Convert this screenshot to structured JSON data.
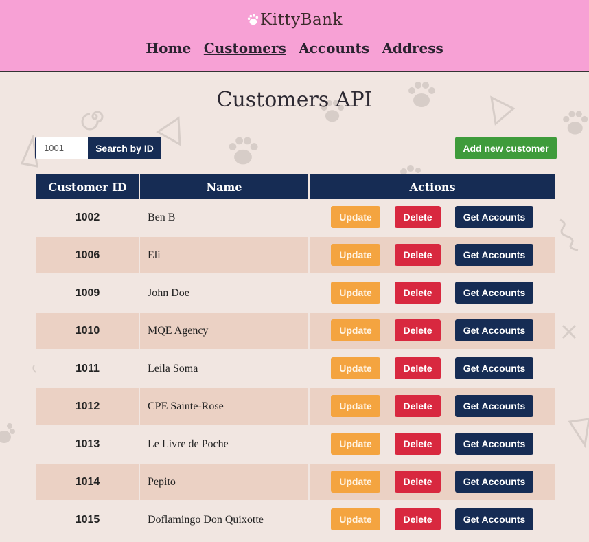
{
  "app": {
    "logo_text": "KittyBank"
  },
  "nav": {
    "items": [
      "Home",
      "Customers",
      "Accounts",
      "Address"
    ],
    "active": "Customers"
  },
  "page": {
    "title": "Customers API"
  },
  "search": {
    "value": "1001",
    "button_label": "Search by ID"
  },
  "toolbar": {
    "add_label": "Add new customer"
  },
  "table": {
    "columns": [
      "Customer ID",
      "Name",
      "Actions"
    ],
    "action_labels": {
      "update": "Update",
      "delete": "Delete",
      "get_accounts": "Get Accounts"
    },
    "rows": [
      {
        "id": "1002",
        "name": "Ben B"
      },
      {
        "id": "1006",
        "name": "Eli"
      },
      {
        "id": "1009",
        "name": "John Doe"
      },
      {
        "id": "1010",
        "name": "MQE Agency"
      },
      {
        "id": "1011",
        "name": "Leila Soma"
      },
      {
        "id": "1012",
        "name": "CPE Sainte-Rose"
      },
      {
        "id": "1013",
        "name": "Le Livre de Poche"
      },
      {
        "id": "1014",
        "name": "Pepito"
      },
      {
        "id": "1015",
        "name": "Doflamingo Don Quixotte"
      }
    ]
  },
  "colors": {
    "header_bg": "#f7a1d5",
    "page_bg": "#f1e6e1",
    "navy": "#162c54",
    "update": "#f4a440",
    "delete": "#d8283f",
    "add": "#3f9b3b",
    "row_alt": "#ebd1c4"
  },
  "icons": [
    "paw-logo-icon",
    "paw-decoration-icon",
    "triangle-decoration-icon",
    "spiral-decoration-icon",
    "squiggle-decoration-icon",
    "cross-decoration-icon"
  ]
}
